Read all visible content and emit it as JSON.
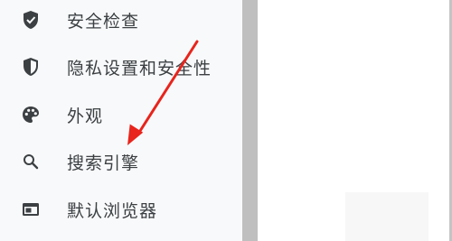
{
  "sidebar": {
    "items": [
      {
        "label": "安全检查",
        "icon": "shield-check-icon"
      },
      {
        "label": "隐私设置和安全性",
        "icon": "shield-half-icon"
      },
      {
        "label": "外观",
        "icon": "palette-icon"
      },
      {
        "label": "搜索引擎",
        "icon": "search-icon"
      },
      {
        "label": "默认浏览器",
        "icon": "browser-window-icon"
      }
    ]
  },
  "annotation": {
    "color": "#e8241c",
    "icon": "red-arrow-annotation"
  },
  "colors": {
    "sidebar_bg": "#f8f9fa",
    "text": "#3c4043",
    "icon": "#3c4043",
    "divider": "#bfbfbf"
  }
}
